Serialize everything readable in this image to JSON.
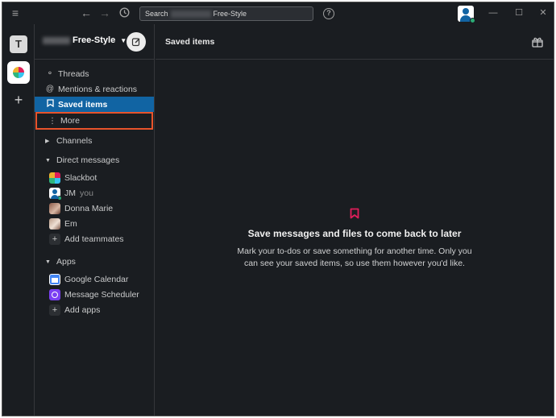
{
  "titlebar": {
    "search_prefix": "Search",
    "search_workspace": "Free-Style"
  },
  "icons": {
    "menu": "hamburger-icon",
    "back": "arrow-left-icon",
    "forward": "arrow-right-icon",
    "history": "clock-icon",
    "help": "question-icon"
  },
  "rail": {
    "workspace_initial": "T",
    "add_label": "+"
  },
  "sidebar": {
    "workspace_name": "Free-Style",
    "nav": [
      {
        "label": "Threads",
        "icon": "threads-icon"
      },
      {
        "label": "Mentions & reactions",
        "icon": "at-icon"
      },
      {
        "label": "Saved items",
        "icon": "bookmark-icon"
      },
      {
        "label": "More",
        "icon": "more-vertical-icon"
      }
    ],
    "channels_label": "Channels",
    "dms_label": "Direct messages",
    "dms": [
      {
        "name": "Slackbot"
      },
      {
        "name": "JM",
        "suffix": "you"
      },
      {
        "name": "Donna Marie"
      },
      {
        "name": "Em"
      }
    ],
    "add_teammates": "Add teammates",
    "apps_label": "Apps",
    "apps": [
      {
        "name": "Google Calendar"
      },
      {
        "name": "Message Scheduler"
      }
    ],
    "add_apps": "Add apps"
  },
  "main": {
    "title": "Saved items",
    "empty_title": "Save messages and files to come back to later",
    "empty_desc": "Mark your to-dos or save something for another time. Only you can see your saved items, so use them however you'd like."
  },
  "colors": {
    "selected": "#1164a3",
    "outline": "#e8532b",
    "bookmark": "#e01e5a",
    "online": "#2bac76"
  }
}
